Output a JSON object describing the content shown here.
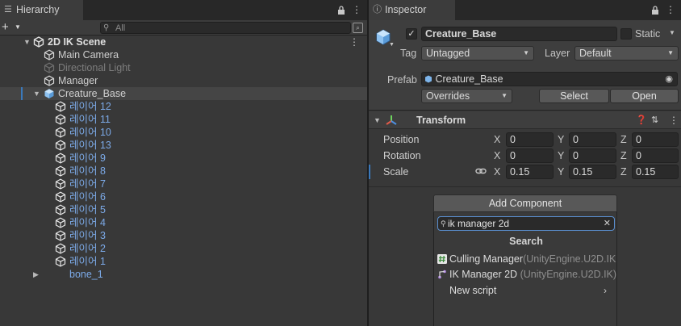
{
  "hierarchy": {
    "tab_title": "Hierarchy",
    "search_placeholder": "All",
    "scene_name": "2D IK Scene",
    "items": [
      {
        "label": "Main Camera",
        "depth": 1,
        "style": "norm"
      },
      {
        "label": "Directional Light",
        "depth": 1,
        "style": "dim"
      },
      {
        "label": "Manager",
        "depth": 1,
        "style": "norm"
      },
      {
        "label": "Creature_Base",
        "depth": 1,
        "style": "norm",
        "selected": true,
        "expanded": true,
        "prefab": true
      },
      {
        "label": "레이어 12",
        "depth": 2,
        "style": "blue"
      },
      {
        "label": "레이어 11",
        "depth": 2,
        "style": "blue"
      },
      {
        "label": "레이어 10",
        "depth": 2,
        "style": "blue"
      },
      {
        "label": "레이어 13",
        "depth": 2,
        "style": "blue"
      },
      {
        "label": "레이어 9",
        "depth": 2,
        "style": "blue"
      },
      {
        "label": "레이어 8",
        "depth": 2,
        "style": "blue"
      },
      {
        "label": "레이어 7",
        "depth": 2,
        "style": "blue"
      },
      {
        "label": "레이어 6",
        "depth": 2,
        "style": "blue"
      },
      {
        "label": "레이어 5",
        "depth": 2,
        "style": "blue"
      },
      {
        "label": "레이어 4",
        "depth": 2,
        "style": "blue"
      },
      {
        "label": "레이어 3",
        "depth": 2,
        "style": "blue"
      },
      {
        "label": "레이어 2",
        "depth": 2,
        "style": "blue"
      },
      {
        "label": "레이어 1",
        "depth": 2,
        "style": "blue"
      },
      {
        "label": "bone_1",
        "depth": 1,
        "style": "blue",
        "collapsed": true,
        "noicon": true
      }
    ]
  },
  "inspector": {
    "tab_title": "Inspector",
    "object_name": "Creature_Base",
    "static_label": "Static",
    "tag_label": "Tag",
    "tag_value": "Untagged",
    "layer_label": "Layer",
    "layer_value": "Default",
    "prefab_label": "Prefab",
    "prefab_value": "Creature_Base",
    "overrides_label": "Overrides",
    "select_label": "Select",
    "open_label": "Open",
    "transform": {
      "title": "Transform",
      "position_label": "Position",
      "rotation_label": "Rotation",
      "scale_label": "Scale",
      "axis_x": "X",
      "axis_y": "Y",
      "axis_z": "Z",
      "position": {
        "x": "0",
        "y": "0",
        "z": "0"
      },
      "rotation": {
        "x": "0",
        "y": "0",
        "z": "0"
      },
      "scale": {
        "x": "0.15",
        "y": "0.15",
        "z": "0.15"
      }
    },
    "add_component": {
      "button_label": "Add Component",
      "search_value": "ik manager 2d",
      "results_title": "Search",
      "results": [
        {
          "name": "Culling Manager",
          "namespace": "(UnityEngine.U2D.IK",
          "icon": "hash-script-icon"
        },
        {
          "name": "IK Manager 2D",
          "namespace": "(UnityEngine.U2D.IK)",
          "icon": "ik-manager-icon"
        }
      ],
      "new_script_label": "New script"
    }
  },
  "colors": {
    "accent": "#3a79bb",
    "child_text": "#7caae8",
    "panel": "#383838"
  }
}
